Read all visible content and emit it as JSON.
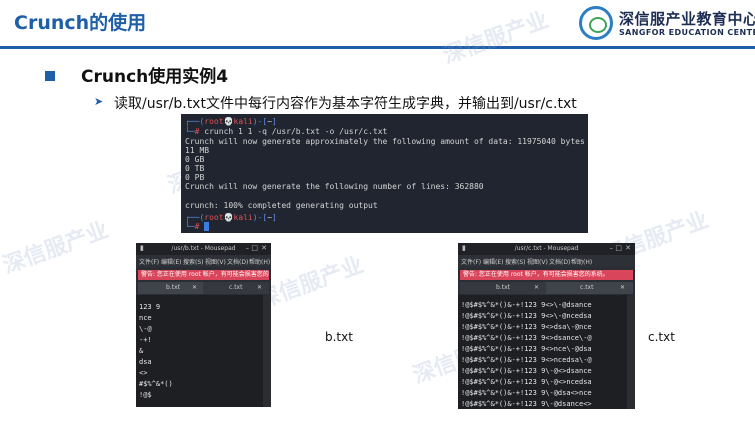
{
  "header": {
    "title": "Crunch的使用",
    "logo_cn": "深信服产业教育中心",
    "logo_en": "SANGFOR EDUCATION CENTER"
  },
  "watermark": {
    "cn": "深信服产业",
    "en": "SANGFOR EDUCATION CENTER"
  },
  "slide": {
    "heading": "Crunch使用实例4",
    "description": "读取/usr/b.txt文件中每行内容作为基本字符生成字典，并输出到/usr/c.txt"
  },
  "terminal": {
    "prompt_root": "root",
    "prompt_host": "kali",
    "prompt_dir": "~",
    "command": "crunch 1 1 -q /usr/b.txt -o /usr/c.txt",
    "output": [
      "Crunch will now generate approximately the following amount of data: 11975040 bytes",
      "11 MB",
      "0 GB",
      "0 TB",
      "0 PB",
      "Crunch will now generate the following number of lines: 362880",
      "",
      "crunch: 100% completed generating output"
    ]
  },
  "b_window": {
    "title": "/usr/b.txt - Mousepad",
    "menu": [
      "文件(F)",
      "编辑(E)",
      "搜索(S)",
      "视图(V)",
      "文档(D)",
      "帮助(H)"
    ],
    "warning": "警告: 您正在使用 root 帐户，有可能会损害您的系统。",
    "tabs": [
      "b.txt",
      "c.txt"
    ],
    "lines": [
      "123 9",
      "nce",
      "\\-@",
      "-+!",
      "&",
      "dsa",
      "<>",
      "#$%^&*()",
      "!@$"
    ],
    "caption": "b.txt"
  },
  "c_window": {
    "title": "/usr/c.txt - Mousepad",
    "menu": [
      "文件(F)",
      "编辑(E)",
      "搜索(S)",
      "视图(V)",
      "文档(D)",
      "帮助(H)"
    ],
    "warning": "警告: 您正在使用 root 帐户，有可能会损害您的系统。",
    "tabs": [
      "b.txt",
      "c.txt"
    ],
    "lines": [
      "!@$#$%^&*()&-+!123 9<>\\-@dsance",
      "!@$#$%^&*()&-+!123 9<>\\-@ncedsa",
      "!@$#$%^&*()&-+!123 9<>dsa\\-@nce",
      "!@$#$%^&*()&-+!123 9<>dsance\\-@",
      "!@$#$%^&*()&-+!123 9<>nce\\-@dsa",
      "!@$#$%^&*()&-+!123 9<>ncedsa\\-@",
      "!@$#$%^&*()&-+!123 9\\-@<>dsance",
      "!@$#$%^&*()&-+!123 9\\-@<>ncedsa",
      "!@$#$%^&*()&-+!123 9\\-@dsa<>nce",
      "!@$#$%^&*()&-+!123 9\\-@dsance<>"
    ],
    "caption": "c.txt"
  },
  "colors": {
    "brand_blue": "#1f5fa8",
    "terminal_bg": "#202530",
    "warning_red": "#d9455a",
    "prompt_red": "#e05252",
    "prompt_blue": "#5a8de8"
  }
}
